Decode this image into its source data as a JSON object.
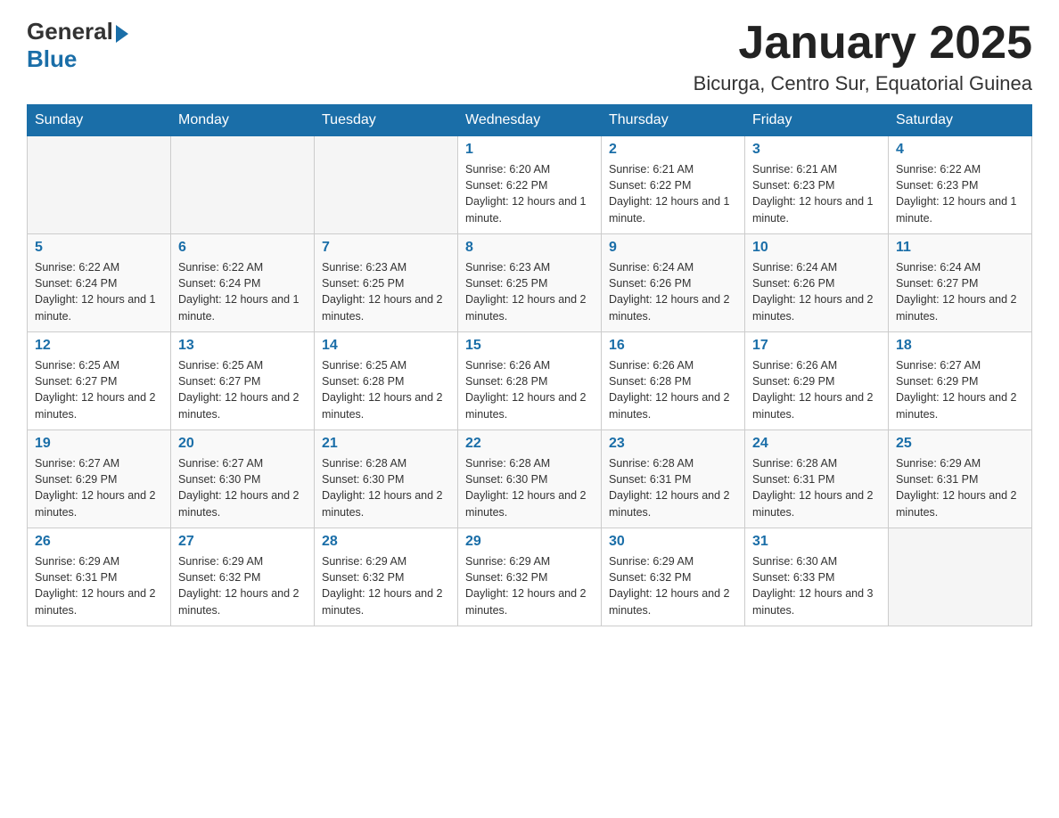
{
  "logo": {
    "general": "General",
    "blue": "Blue"
  },
  "title": "January 2025",
  "subtitle": "Bicurga, Centro Sur, Equatorial Guinea",
  "days_of_week": [
    "Sunday",
    "Monday",
    "Tuesday",
    "Wednesday",
    "Thursday",
    "Friday",
    "Saturday"
  ],
  "weeks": [
    [
      {
        "day": "",
        "info": ""
      },
      {
        "day": "",
        "info": ""
      },
      {
        "day": "",
        "info": ""
      },
      {
        "day": "1",
        "info": "Sunrise: 6:20 AM\nSunset: 6:22 PM\nDaylight: 12 hours and 1 minute."
      },
      {
        "day": "2",
        "info": "Sunrise: 6:21 AM\nSunset: 6:22 PM\nDaylight: 12 hours and 1 minute."
      },
      {
        "day": "3",
        "info": "Sunrise: 6:21 AM\nSunset: 6:23 PM\nDaylight: 12 hours and 1 minute."
      },
      {
        "day": "4",
        "info": "Sunrise: 6:22 AM\nSunset: 6:23 PM\nDaylight: 12 hours and 1 minute."
      }
    ],
    [
      {
        "day": "5",
        "info": "Sunrise: 6:22 AM\nSunset: 6:24 PM\nDaylight: 12 hours and 1 minute."
      },
      {
        "day": "6",
        "info": "Sunrise: 6:22 AM\nSunset: 6:24 PM\nDaylight: 12 hours and 1 minute."
      },
      {
        "day": "7",
        "info": "Sunrise: 6:23 AM\nSunset: 6:25 PM\nDaylight: 12 hours and 2 minutes."
      },
      {
        "day": "8",
        "info": "Sunrise: 6:23 AM\nSunset: 6:25 PM\nDaylight: 12 hours and 2 minutes."
      },
      {
        "day": "9",
        "info": "Sunrise: 6:24 AM\nSunset: 6:26 PM\nDaylight: 12 hours and 2 minutes."
      },
      {
        "day": "10",
        "info": "Sunrise: 6:24 AM\nSunset: 6:26 PM\nDaylight: 12 hours and 2 minutes."
      },
      {
        "day": "11",
        "info": "Sunrise: 6:24 AM\nSunset: 6:27 PM\nDaylight: 12 hours and 2 minutes."
      }
    ],
    [
      {
        "day": "12",
        "info": "Sunrise: 6:25 AM\nSunset: 6:27 PM\nDaylight: 12 hours and 2 minutes."
      },
      {
        "day": "13",
        "info": "Sunrise: 6:25 AM\nSunset: 6:27 PM\nDaylight: 12 hours and 2 minutes."
      },
      {
        "day": "14",
        "info": "Sunrise: 6:25 AM\nSunset: 6:28 PM\nDaylight: 12 hours and 2 minutes."
      },
      {
        "day": "15",
        "info": "Sunrise: 6:26 AM\nSunset: 6:28 PM\nDaylight: 12 hours and 2 minutes."
      },
      {
        "day": "16",
        "info": "Sunrise: 6:26 AM\nSunset: 6:28 PM\nDaylight: 12 hours and 2 minutes."
      },
      {
        "day": "17",
        "info": "Sunrise: 6:26 AM\nSunset: 6:29 PM\nDaylight: 12 hours and 2 minutes."
      },
      {
        "day": "18",
        "info": "Sunrise: 6:27 AM\nSunset: 6:29 PM\nDaylight: 12 hours and 2 minutes."
      }
    ],
    [
      {
        "day": "19",
        "info": "Sunrise: 6:27 AM\nSunset: 6:29 PM\nDaylight: 12 hours and 2 minutes."
      },
      {
        "day": "20",
        "info": "Sunrise: 6:27 AM\nSunset: 6:30 PM\nDaylight: 12 hours and 2 minutes."
      },
      {
        "day": "21",
        "info": "Sunrise: 6:28 AM\nSunset: 6:30 PM\nDaylight: 12 hours and 2 minutes."
      },
      {
        "day": "22",
        "info": "Sunrise: 6:28 AM\nSunset: 6:30 PM\nDaylight: 12 hours and 2 minutes."
      },
      {
        "day": "23",
        "info": "Sunrise: 6:28 AM\nSunset: 6:31 PM\nDaylight: 12 hours and 2 minutes."
      },
      {
        "day": "24",
        "info": "Sunrise: 6:28 AM\nSunset: 6:31 PM\nDaylight: 12 hours and 2 minutes."
      },
      {
        "day": "25",
        "info": "Sunrise: 6:29 AM\nSunset: 6:31 PM\nDaylight: 12 hours and 2 minutes."
      }
    ],
    [
      {
        "day": "26",
        "info": "Sunrise: 6:29 AM\nSunset: 6:31 PM\nDaylight: 12 hours and 2 minutes."
      },
      {
        "day": "27",
        "info": "Sunrise: 6:29 AM\nSunset: 6:32 PM\nDaylight: 12 hours and 2 minutes."
      },
      {
        "day": "28",
        "info": "Sunrise: 6:29 AM\nSunset: 6:32 PM\nDaylight: 12 hours and 2 minutes."
      },
      {
        "day": "29",
        "info": "Sunrise: 6:29 AM\nSunset: 6:32 PM\nDaylight: 12 hours and 2 minutes."
      },
      {
        "day": "30",
        "info": "Sunrise: 6:29 AM\nSunset: 6:32 PM\nDaylight: 12 hours and 2 minutes."
      },
      {
        "day": "31",
        "info": "Sunrise: 6:30 AM\nSunset: 6:33 PM\nDaylight: 12 hours and 3 minutes."
      },
      {
        "day": "",
        "info": ""
      }
    ]
  ]
}
